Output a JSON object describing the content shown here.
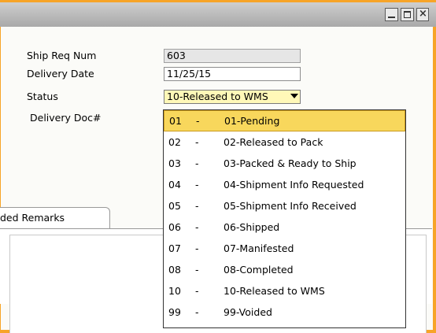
{
  "window": {
    "title": ""
  },
  "form": {
    "ship_req_num_label": "Ship Req Num",
    "ship_req_num_value": "603",
    "delivery_date_label": "Delivery Date",
    "delivery_date_value": "11/25/15",
    "status_label": "Status",
    "status_value": "10-Released to WMS",
    "delivery_doc_label": "Delivery Doc#"
  },
  "tabs": {
    "remarks_label": "ded Remarks"
  },
  "dropdown": {
    "options": [
      {
        "code": "01",
        "sep": "-",
        "text": "01-Pending",
        "highlighted": true
      },
      {
        "code": "02",
        "sep": "-",
        "text": "02-Released to Pack"
      },
      {
        "code": "03",
        "sep": "-",
        "text": "03-Packed & Ready to Ship"
      },
      {
        "code": "04",
        "sep": "-",
        "text": "04-Shipment Info Requested"
      },
      {
        "code": "05",
        "sep": "-",
        "text": "05-Shipment Info Received"
      },
      {
        "code": "06",
        "sep": "-",
        "text": "06-Shipped"
      },
      {
        "code": "07",
        "sep": "-",
        "text": "07-Manifested"
      },
      {
        "code": "08",
        "sep": "-",
        "text": "08-Completed"
      },
      {
        "code": "10",
        "sep": "-",
        "text": "10-Released to WMS"
      },
      {
        "code": "99",
        "sep": "-",
        "text": "99-Voided"
      }
    ]
  },
  "colors": {
    "accent": "#f7a428",
    "highlight": "#f8d75c",
    "select_bg": "#fff8b8"
  }
}
